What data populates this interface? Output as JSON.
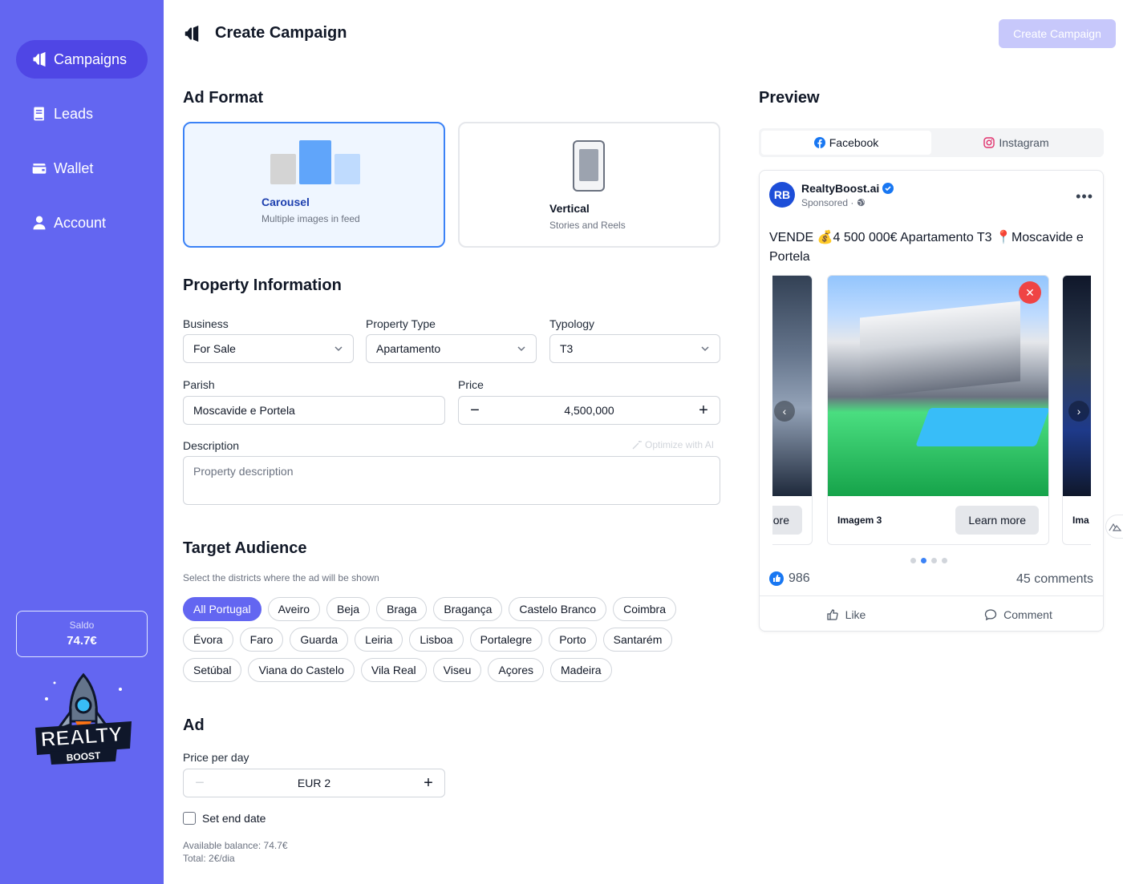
{
  "sidebar": {
    "items": [
      {
        "label": "Campaigns",
        "icon": "megaphone-icon",
        "active": true
      },
      {
        "label": "Leads",
        "icon": "book-icon"
      },
      {
        "label": "Wallet",
        "icon": "wallet-icon"
      },
      {
        "label": "Account",
        "icon": "user-icon"
      }
    ],
    "balance_label": "Saldo",
    "balance_value": "74.7€",
    "logo_text_main": "REALTY",
    "logo_text_sub": "BOOST"
  },
  "header": {
    "title": "Create Campaign",
    "create_button": "Create Campaign"
  },
  "ad_format": {
    "heading": "Ad Format",
    "options": [
      {
        "title": "Carousel",
        "subtitle": "Multiple images in feed",
        "selected": true
      },
      {
        "title": "Vertical",
        "subtitle": "Stories and Reels",
        "selected": false
      }
    ]
  },
  "property": {
    "heading": "Property Information",
    "business_label": "Business",
    "business_value": "For Sale",
    "type_label": "Property Type",
    "type_value": "Apartamento",
    "typology_label": "Typology",
    "typology_value": "T3",
    "parish_label": "Parish",
    "parish_value": "Moscavide e Portela",
    "price_label": "Price",
    "price_value": "4,500,000",
    "description_label": "Description",
    "description_placeholder": "Property description",
    "optimize_label": "Optimize with AI"
  },
  "audience": {
    "heading": "Target Audience",
    "hint": "Select the districts where the ad will be shown",
    "rows": [
      [
        "All Portugal",
        "Aveiro",
        "Beja",
        "Braga",
        "Bragança",
        "Castelo Branco",
        "Coimbra"
      ],
      [
        "Évora",
        "Faro",
        "Guarda",
        "Leiria",
        "Lisboa",
        "Portalegre",
        "Porto",
        "Santarém"
      ],
      [
        "Setúbal",
        "Viana do Castelo",
        "Vila Real",
        "Viseu",
        "Açores",
        "Madeira"
      ]
    ],
    "selected": "All Portugal"
  },
  "ad": {
    "heading": "Ad",
    "price_day_label": "Price per day",
    "price_day_value": "EUR 2",
    "end_date_label": "Set end date",
    "available_balance": "Available balance: 74.7€",
    "total": "Total: 2€/dia"
  },
  "preview": {
    "heading": "Preview",
    "tabs": [
      {
        "label": "Facebook",
        "active": true
      },
      {
        "label": "Instagram",
        "active": false
      }
    ],
    "page_name": "RealtyBoost.ai",
    "avatar_text": "RB",
    "sponsored": "Sponsored ·",
    "post_text": "VENDE 💰4 500 000€ Apartamento T3 📍Moscavide e Portela",
    "slides": [
      {
        "caption": "",
        "cta": "ore"
      },
      {
        "caption": "Imagem 3",
        "cta": "Learn more"
      },
      {
        "caption": "Ima",
        "cta": ""
      }
    ],
    "close_glyph": "✕",
    "likes": "986",
    "comments": "45 comments",
    "like_action": "Like",
    "comment_action": "Comment",
    "active_dot": 1,
    "dot_count": 4
  },
  "colors": {
    "sidebar": "#6366f1",
    "accent": "#3b82f6",
    "active_chip": "#6366f1"
  }
}
